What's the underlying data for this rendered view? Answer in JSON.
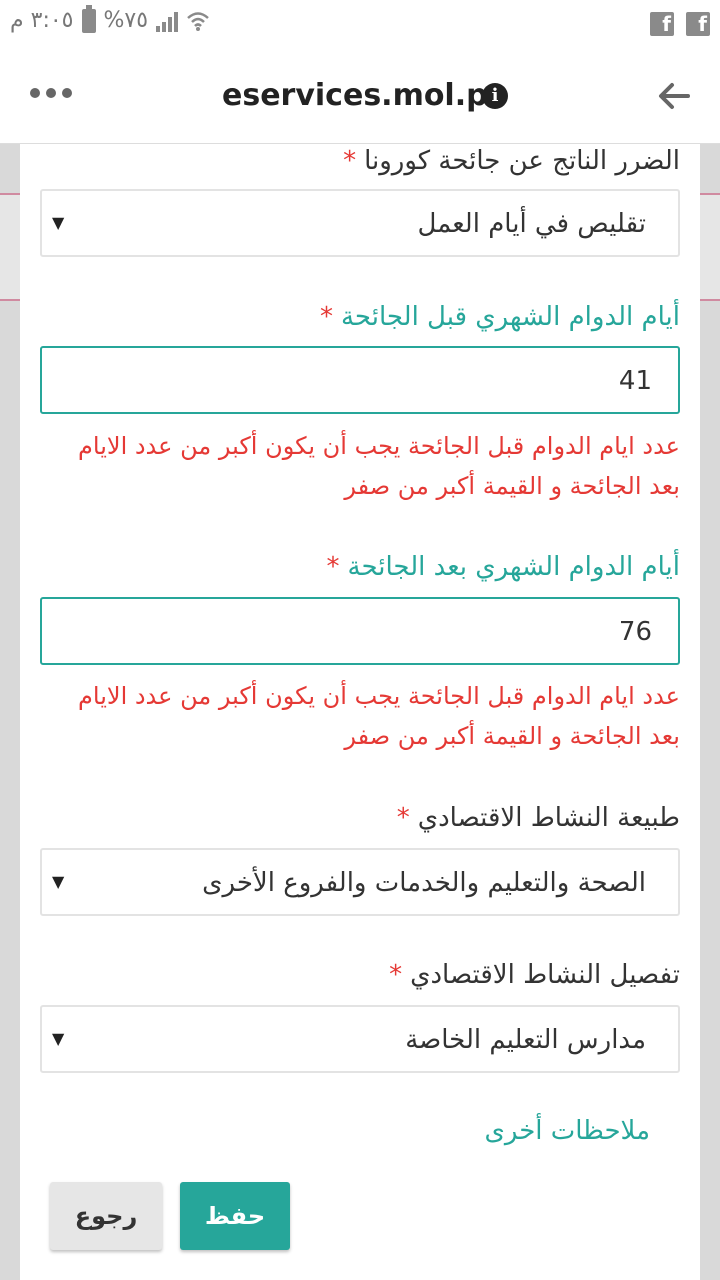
{
  "status_bar": {
    "time": "٣:٠٥ م",
    "battery_text": "%٧٥",
    "icons": [
      "battery-icon",
      "signal-icon",
      "wifi-icon",
      "facebook-icon",
      "facebook-icon"
    ]
  },
  "browser": {
    "url": "eservices.mol.ps",
    "info_glyph": "i"
  },
  "form": {
    "corona_damage": {
      "label": "الضرر الناتج عن جائحة كورونا",
      "required_mark": "*",
      "value": "تقليص في أيام العمل"
    },
    "days_before": {
      "label": "أيام الدوام الشهري قبل الجائحة",
      "required_mark": "*",
      "value": "41",
      "error": "عدد ايام الدوام قبل الجائحة يجب أن يكون أكبر من عدد الايام بعد الجائحة و القيمة أكبر من صفر"
    },
    "days_after": {
      "label": "أيام الدوام الشهري بعد الجائحة",
      "required_mark": "*",
      "value": "76",
      "error": "عدد ايام الدوام قبل الجائحة يجب أن يكون أكبر من عدد الايام بعد الجائحة و القيمة أكبر من صفر"
    },
    "activity_nature": {
      "label": "طبيعة النشاط الاقتصادي",
      "required_mark": "*",
      "value": "الصحة والتعليم والخدمات والفروع الأخرى"
    },
    "activity_detail": {
      "label": "تفصيل النشاط الاقتصادي",
      "required_mark": "*",
      "value": "مدارس التعليم الخاصة"
    },
    "notes_label": "ملاحظات أخرى",
    "save_label": "حفظ",
    "back_label": "رجوع"
  },
  "colors": {
    "accent": "#26a69a",
    "error": "#e53935"
  }
}
